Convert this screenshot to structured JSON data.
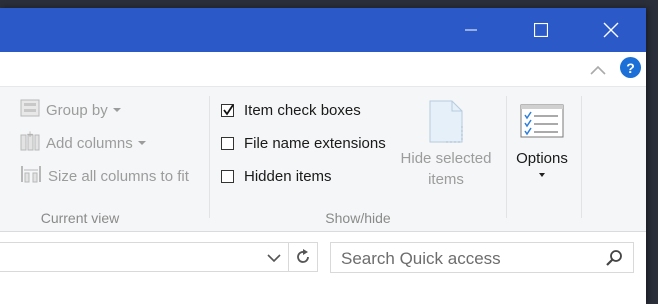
{
  "window": {
    "controls": {
      "minimize_icon": "minimize-icon",
      "maximize_icon": "maximize-icon",
      "close_icon": "close-icon"
    }
  },
  "ribbon": {
    "help_label": "?",
    "current_view": {
      "group_label": "Current view",
      "group_by_label": "Group by",
      "add_columns_label": "Add columns",
      "size_columns_label": "Size all columns to fit"
    },
    "show_hide": {
      "group_label": "Show/hide",
      "item_check_boxes": {
        "label": "Item check boxes",
        "checked": true
      },
      "file_name_extensions": {
        "label": "File name extensions",
        "checked": false
      },
      "hidden_items": {
        "label": "Hidden items",
        "checked": false
      },
      "hide_selected_line1": "Hide selected",
      "hide_selected_line2": "items"
    },
    "options": {
      "label": "Options"
    }
  },
  "address_bar": {
    "search_placeholder": "Search Quick access"
  },
  "colors": {
    "titlebar": "#2b59c8",
    "help": "#1c6fd6",
    "disabled_text": "#9c9c9c"
  }
}
